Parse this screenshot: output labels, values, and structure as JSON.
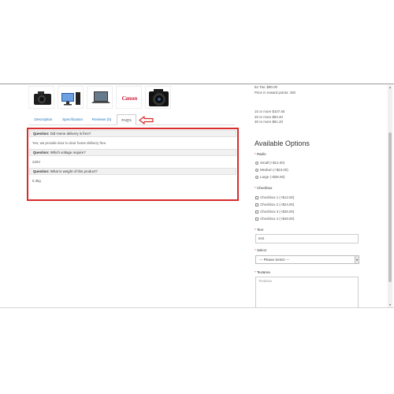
{
  "product_images": [
    {
      "icon": "dslr-camera-icon"
    },
    {
      "icon": "desktop-computer-icon"
    },
    {
      "icon": "laptop-icon"
    },
    {
      "icon": "canon-logo",
      "text": "Canon"
    },
    {
      "icon": "dslr-camera-large-icon"
    }
  ],
  "tabs": [
    {
      "label": "Description",
      "active": false
    },
    {
      "label": "Specification",
      "active": false
    },
    {
      "label": "Reviews (0)",
      "active": false
    },
    {
      "label": "FAQ's",
      "active": true
    }
  ],
  "faq": {
    "question_prefix": "Question:",
    "items": [
      {
        "question": "Did Home delivery is free?",
        "answer": "Yes, we provide door to door home delivery free."
      },
      {
        "question": "Which voltage require?",
        "answer": "220V"
      },
      {
        "question": "What is weight of this product?",
        "answer": "5.3kg"
      }
    ]
  },
  "pricing": {
    "ex_tax": "Ex Tax: $90.00",
    "reward_points": "Price in reward points: 400",
    "discounts": [
      "10 or more $107.60",
      "20 or more $94.40",
      "30 or more $81.20"
    ]
  },
  "options": {
    "heading": "Available Options",
    "radio_label": "Radio",
    "radio_options": [
      "Small (+$12.00)",
      "Medium (+$24.00)",
      "Large (+$36.00)"
    ],
    "checkbox_label": "Checkbox",
    "checkbox_options": [
      "Checkbox 1 (+$12.00)",
      "Checkbox 2 (+$24.00)",
      "Checkbox 3 (+$36.00)",
      "Checkbox 4 (+$48.00)"
    ],
    "text_label": "Text",
    "text_value": "test",
    "select_label": "Select",
    "select_value": "--- Please Select ---",
    "textarea_label": "Textarea",
    "textarea_placeholder": "Textarea"
  },
  "colors": {
    "highlight": "#d82b2b",
    "link": "#1a73b8"
  }
}
